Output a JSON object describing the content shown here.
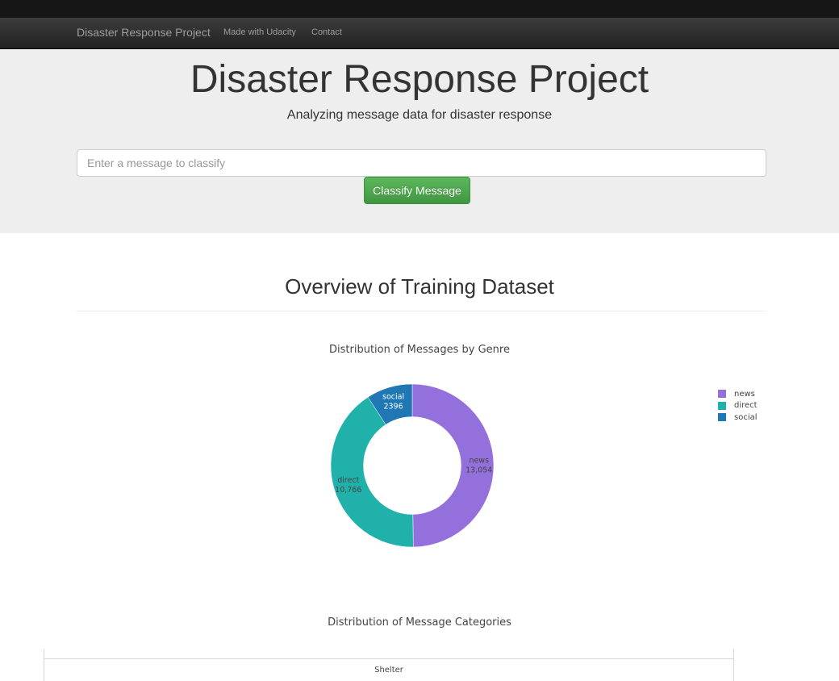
{
  "navbar": {
    "brand": "Disaster Response Project",
    "links": [
      "Made with Udacity",
      "Contact"
    ]
  },
  "hero": {
    "title": "Disaster Response Project",
    "subtitle": "Analyzing message data for disaster response",
    "input_placeholder": "Enter a message to classify",
    "button_label": "Classify Message"
  },
  "section": {
    "title": "Overview of Training Dataset"
  },
  "chart_data": [
    {
      "type": "pie",
      "hole": true,
      "title": "Distribution of Messages by Genre",
      "categories": [
        "news",
        "direct",
        "social"
      ],
      "values": [
        13054,
        10766,
        2396
      ],
      "value_labels": [
        "13,054",
        "10,766",
        "2396"
      ],
      "colors": [
        "#9370DB",
        "#20B2AA",
        "#1F77B4"
      ],
      "legend": "right"
    },
    {
      "type": "bar",
      "title": "Distribution of Message Categories",
      "categories": [
        "Shelter"
      ]
    }
  ]
}
